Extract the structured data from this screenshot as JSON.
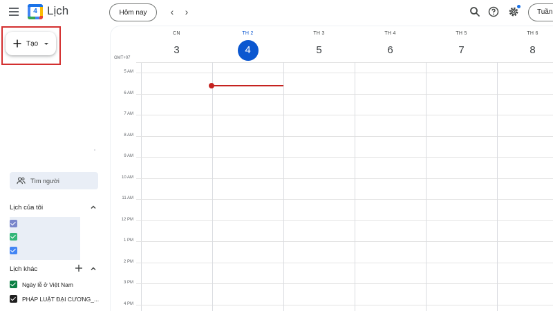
{
  "header": {
    "app_title": "Lịch",
    "logo_day": "4",
    "today_label": "Hôm nay",
    "prev_glyph": "‹",
    "next_glyph": "›",
    "view_label": "Tuần",
    "icons": [
      "menu-icon",
      "search-icon",
      "help-icon",
      "settings-icon"
    ]
  },
  "sidebar": {
    "create_label": "Tạo",
    "people_search_placeholder": "Tìm người",
    "my_calendars_title": "Lịch của tôi",
    "my_calendars": [
      {
        "label": "",
        "color": "#7986cb"
      },
      {
        "label": "",
        "color": "#33b679"
      },
      {
        "label": "",
        "color": "#4285f4"
      }
    ],
    "other_calendars_title": "Lịch khác",
    "other_calendars": [
      {
        "label": "Ngày lễ ở Việt Nam",
        "color": "#0b8043"
      },
      {
        "label": "PHÁP LUẬT ĐẠI CƯƠNG_...",
        "color": "#1f1f1f"
      }
    ]
  },
  "calendar": {
    "timezone": "GMT+07",
    "today_color": "#0b57d0",
    "now_indicator_color": "#c5221f",
    "days": [
      {
        "name": "CN",
        "date": "3",
        "today": false
      },
      {
        "name": "TH 2",
        "date": "4",
        "today": true
      },
      {
        "name": "TH 3",
        "date": "5",
        "today": false
      },
      {
        "name": "TH 4",
        "date": "6",
        "today": false
      },
      {
        "name": "TH 5",
        "date": "7",
        "today": false
      },
      {
        "name": "TH 6",
        "date": "8",
        "today": false
      }
    ],
    "hours": [
      "5 AM",
      "6 AM",
      "7 AM",
      "8 AM",
      "9 AM",
      "10 AM",
      "11 AM",
      "12 PM",
      "1 PM",
      "2 PM",
      "3 PM",
      "4 PM"
    ]
  }
}
